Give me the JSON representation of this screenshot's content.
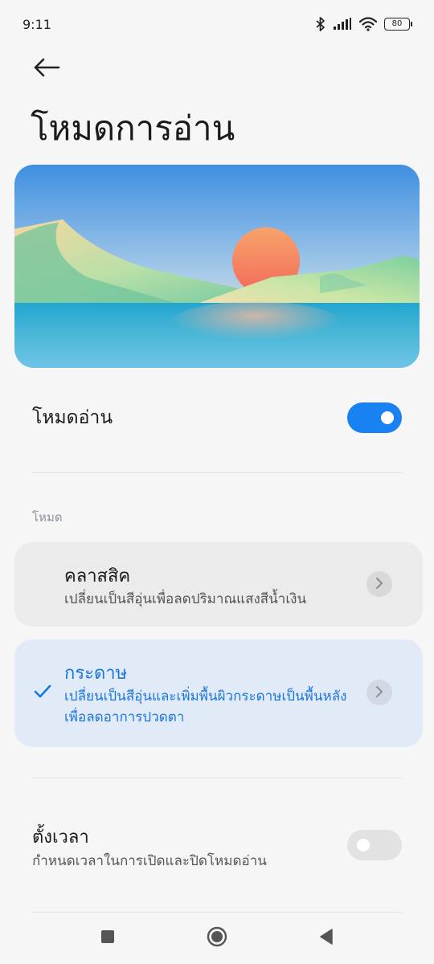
{
  "status_bar": {
    "time": "9:11",
    "battery_level": "80",
    "icons": [
      "bluetooth-icon",
      "signal-icon",
      "wifi-icon",
      "battery-icon"
    ]
  },
  "header": {
    "title": "โหมดการอ่าน"
  },
  "reading_mode": {
    "label": "โหมดอ่าน",
    "enabled": true
  },
  "modes_section": {
    "label": "โหมด",
    "items": [
      {
        "title": "คลาสสิค",
        "description": "เปลี่ยนเป็นสีอุ่นเพื่อลดปริมาณแสงสีน้ำเงิน",
        "selected": false
      },
      {
        "title": "กระดาษ",
        "description": "เปลี่ยนเป็นสีอุ่นและเพิ่มพื้นผิวกระดาษเป็นพื้นหลังเพื่อลดอาการปวดตา",
        "selected": true
      }
    ]
  },
  "schedule": {
    "label": "ตั้งเวลา",
    "description": "กำหนดเวลาในการเปิดและปิดโหมดอ่าน",
    "enabled": false
  },
  "colors": {
    "accent": "#1882f3",
    "selected_card_bg": "#e1ebf8",
    "selected_text": "#1a76dc"
  },
  "nav_bar": {
    "icons": [
      "recents-square-icon",
      "home-circle-icon",
      "back-triangle-icon"
    ]
  }
}
